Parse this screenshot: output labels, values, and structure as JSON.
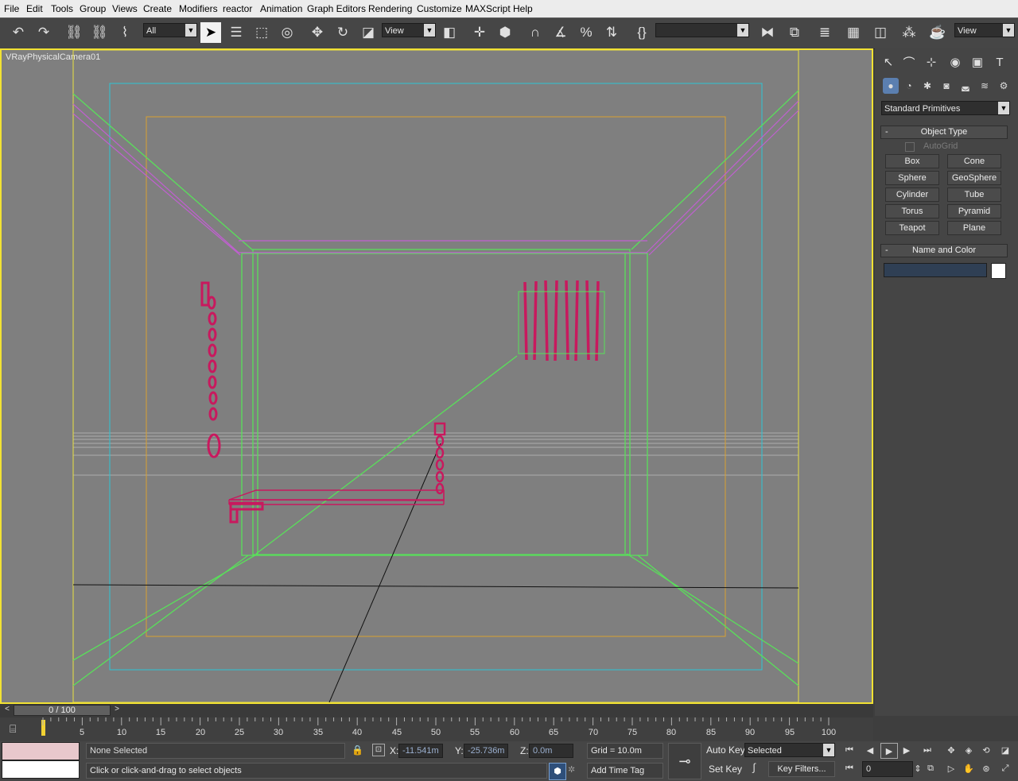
{
  "menu": [
    "File",
    "Edit",
    "Tools",
    "Group",
    "Views",
    "Create",
    "Modifiers",
    "reactor",
    "Animation",
    "Graph Editors",
    "Rendering",
    "Customize",
    "MAXScript",
    "Help"
  ],
  "toolbar": {
    "selection_filter": "All",
    "ref_coord": "View",
    "named_selection": "",
    "render_view": "View"
  },
  "viewport": {
    "label": "VRayPhysicalCamera01"
  },
  "command_panel": {
    "category": "Standard Primitives",
    "object_type_title": "Object Type",
    "autogrid_label": "AutoGrid",
    "primitives": [
      "Box",
      "Cone",
      "Sphere",
      "GeoSphere",
      "Cylinder",
      "Tube",
      "Torus",
      "Pyramid",
      "Teapot",
      "Plane"
    ],
    "name_color_title": "Name and Color",
    "name_value": ""
  },
  "timeline": {
    "slider_label": "0 / 100",
    "ticks": [
      "5",
      "10",
      "15",
      "20",
      "25",
      "30",
      "35",
      "40",
      "45",
      "50",
      "55",
      "60",
      "65",
      "70",
      "75",
      "80",
      "85",
      "90",
      "95",
      "100"
    ]
  },
  "status": {
    "selection": "None Selected",
    "prompt": "Click or click-and-drag to select objects",
    "x_label": "X:",
    "x_value": "-11.541m",
    "y_label": "Y:",
    "y_value": "-25.736m",
    "z_label": "Z:",
    "z_value": "0.0m",
    "grid": "Grid = 10.0m",
    "add_time_tag": "Add Time Tag",
    "auto_key": "Auto Key",
    "set_key": "Set Key",
    "key_mode": "Selected",
    "key_filters": "Key Filters...",
    "current_frame": "0"
  },
  "colors": {
    "viewport_border": "#f2e233",
    "selection_color": "#c8195e",
    "wire_green": "#59e05a",
    "wire_cyan": "#2ec4d4",
    "wire_magenta": "#c060d0"
  }
}
